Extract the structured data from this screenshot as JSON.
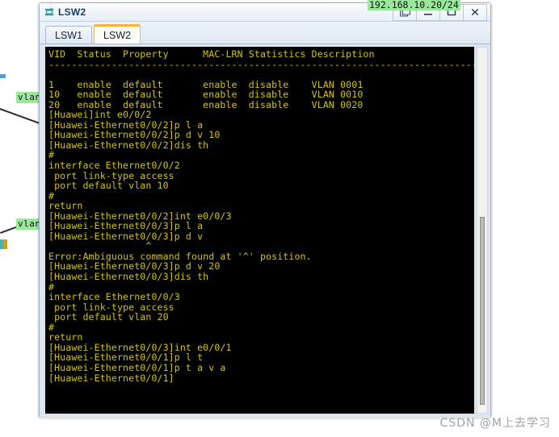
{
  "background": {
    "ip_label": "192.168.10.20/24",
    "vlan_tag_upper": "vlan",
    "vlan_tag_lower": "vlan"
  },
  "window": {
    "title": "LSW2",
    "icon": "switch-icon",
    "buttons": [
      {
        "name": "restore-button",
        "glyph": "❐"
      },
      {
        "name": "minimize-button",
        "glyph": "–"
      },
      {
        "name": "maximize-button",
        "glyph": "❐"
      },
      {
        "name": "close-button",
        "glyph": "X"
      }
    ],
    "tabs": [
      {
        "label": "LSW1",
        "active": false
      },
      {
        "label": "LSW2",
        "active": true
      }
    ]
  },
  "console": {
    "accent_color": "#d4c400",
    "background_color": "#000000",
    "text": "VID  Status  Property      MAC-LRN Statistics Description\n--------------------------------------------------------------------------------\n\n1    enable  default       enable  disable    VLAN 0001\n10   enable  default       enable  disable    VLAN 0010\n20   enable  default       enable  disable    VLAN 0020\n[Huawei]int e0/0/2\n[Huawei-Ethernet0/0/2]p l a\n[Huawei-Ethernet0/0/2]p d v 10\n[Huawei-Ethernet0/0/2]dis th\n#\ninterface Ethernet0/0/2\n port link-type access\n port default vlan 10\n#\nreturn\n[Huawei-Ethernet0/0/2]int e0/0/3\n[Huawei-Ethernet0/0/3]p l a\n[Huawei-Ethernet0/0/3]p d v\n                 ^\nError:Ambiguous command found at '^' position.\n[Huawei-Ethernet0/0/3]p d v 20\n[Huawei-Ethernet0/0/3]dis th\n#\ninterface Ethernet0/0/3\n port link-type access\n port default vlan 20\n#\nreturn\n[Huawei-Ethernet0/0/3]int e0/0/1\n[Huawei-Ethernet0/0/1]p l t\n[Huawei-Ethernet0/0/1]p t a v a\n[Huawei-Ethernet0/0/1]"
  },
  "watermark": {
    "text": "CSDN @M上去学习"
  }
}
